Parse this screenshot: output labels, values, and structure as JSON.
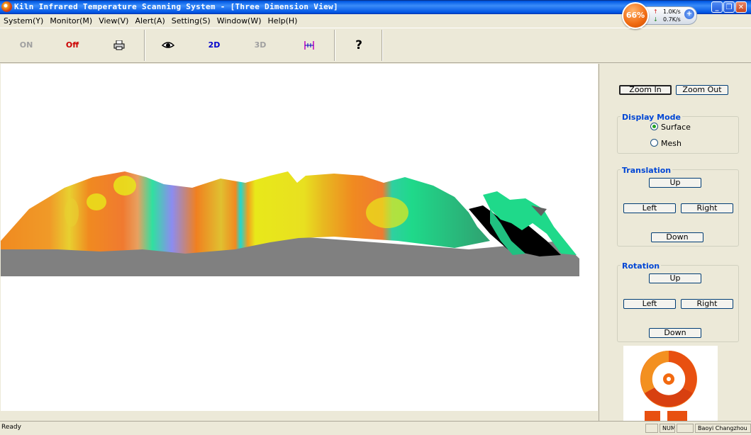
{
  "window": {
    "title": "Kiln Infrared Temperature Scanning System - [Three Dimension View]",
    "minimize": "_",
    "restore": "❐",
    "close": "✕"
  },
  "netmon": {
    "percent": "66%",
    "up_rate": "1.0K/s",
    "down_rate": "0.7K/s"
  },
  "menu": [
    "System(Y)",
    "Monitor(M)",
    "View(V)",
    "Alert(A)",
    "Setting(S)",
    "Window(W)",
    "Help(H)"
  ],
  "toolbar": {
    "on_label": "ON",
    "off_label": "Off",
    "print_icon": "printer-icon",
    "eye_icon": "eye-icon",
    "btn_2d_label": "2D",
    "btn_3d_label": "3D",
    "ruler_icon": "ruler-icon",
    "help_icon": "help-icon",
    "help_glyph": "?"
  },
  "panel": {
    "zoom_in": "Zoom In",
    "zoom_out": "Zoom Out",
    "display_mode": {
      "title": "Display Mode",
      "options": [
        "Surface",
        "Mesh"
      ],
      "selected": "Surface"
    },
    "translation": {
      "title": "Translation",
      "up": "Up",
      "left": "Left",
      "right": "Right",
      "down": "Down"
    },
    "rotation": {
      "title": "Rotation",
      "up": "Up",
      "left": "Left",
      "right": "Right",
      "down": "Down"
    }
  },
  "status": {
    "text": "Ready",
    "num": "NUM",
    "company": "Baoyi Changzhou"
  },
  "colors": {
    "title_blue": "#0055e5",
    "group_title": "#0046d5",
    "off_red": "#cc0000",
    "twod_blue": "#0000cc",
    "surface_orange": "#f08a20",
    "surface_yellow": "#e8e81a",
    "surface_blue": "#8c8cf0",
    "surface_green": "#1fd98a",
    "ground_gray": "#808080"
  }
}
